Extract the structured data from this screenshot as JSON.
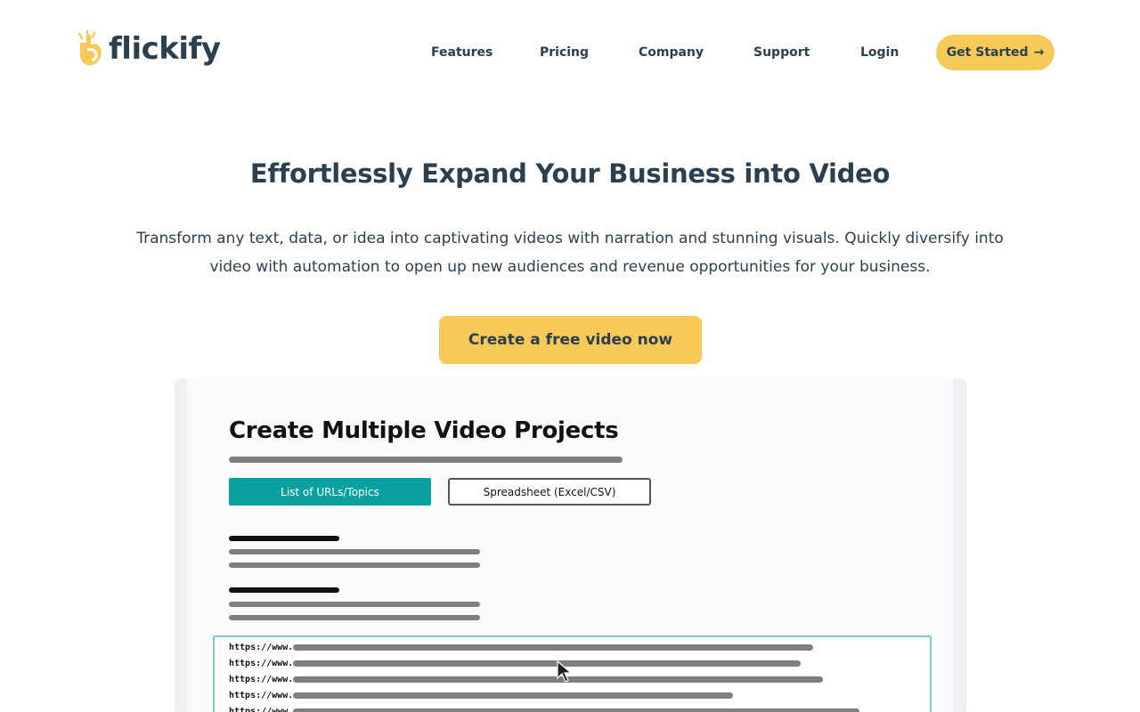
{
  "header": {
    "logo_text": "flickify",
    "nav": {
      "features": "Features",
      "pricing": "Pricing",
      "company": "Company",
      "support": "Support",
      "login": "Login"
    },
    "cta_label": "Get Started",
    "cta_arrow": "→"
  },
  "hero": {
    "title": "Effortlessly Expand Your Business into Video",
    "subtitle": "Transform any text, data, or idea into captivating videos with narration and stunning visuals.  Quickly diversify into video with automation to open up new audiences and revenue opportunities for your business.",
    "cta_label": "Create a free video now"
  },
  "demo": {
    "title": "Create Multiple Video Projects",
    "tab_active": "List of URLs/Topics",
    "tab_inactive": "Spreadsheet (Excel/CSV)",
    "url_prefix": "https://www.",
    "colors": {
      "accent": "#0aa0a0",
      "brand_yellow": "#f6c959",
      "text_dark": "#2b3f4e"
    }
  }
}
